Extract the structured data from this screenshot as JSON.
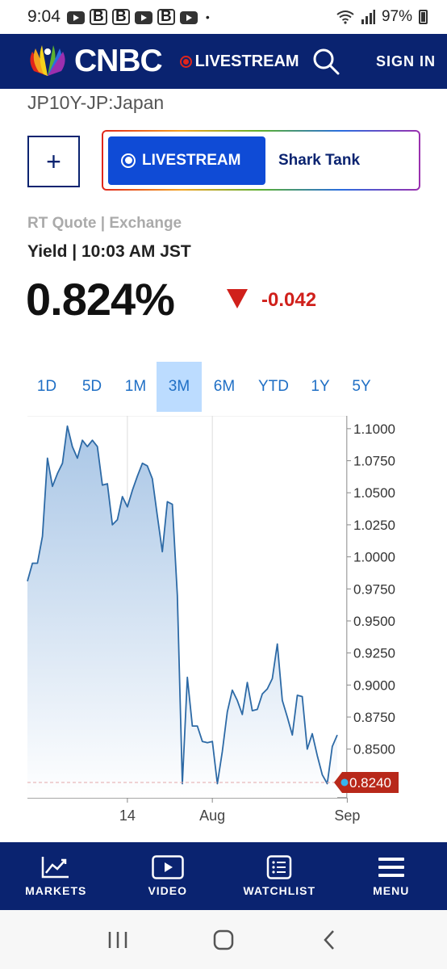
{
  "status_bar": {
    "time": "9:04",
    "notif_b": "B",
    "dot": "•",
    "battery": "97%"
  },
  "header": {
    "brand": "CNBC",
    "livestream": "LIVESTREAM",
    "sign_in": "SIGN IN"
  },
  "page_title": "JP10Y-JP:Japan",
  "promo": {
    "plus": "+",
    "live_label": "LIVESTREAM",
    "show": "Shark Tank"
  },
  "quote": {
    "meta": "RT Quote | Exchange",
    "yield_line": "Yield | 10:03 AM JST",
    "price": "0.824%",
    "change": "-0.042"
  },
  "ranges": [
    {
      "label": "1D",
      "active": false
    },
    {
      "label": "5D",
      "active": false
    },
    {
      "label": "1M",
      "active": false
    },
    {
      "label": "3M",
      "active": true
    },
    {
      "label": "6M",
      "active": false
    },
    {
      "label": "YTD",
      "active": false
    },
    {
      "label": "1Y",
      "active": false
    },
    {
      "label": "5Y",
      "active": false
    }
  ],
  "chart_data": {
    "type": "area",
    "ylim": [
      0.812,
      1.11
    ],
    "yticks": [
      "1.1000",
      "1.0750",
      "1.0500",
      "1.0250",
      "1.0000",
      "0.9750",
      "0.9500",
      "0.9250",
      "0.9000",
      "0.8750",
      "0.8500"
    ],
    "xticks": [
      {
        "label": "14",
        "x": 20
      },
      {
        "label": "Aug",
        "x": 37
      },
      {
        "label": "Sep",
        "x": 64
      }
    ],
    "last_value": "0.8240",
    "last": 0.824,
    "line_color": "#2d6aa6",
    "fill_top": "#a9c6e6",
    "values": [
      0.981,
      0.995,
      0.995,
      1.016,
      1.077,
      1.055,
      1.065,
      1.073,
      1.102,
      1.086,
      1.077,
      1.091,
      1.086,
      1.091,
      1.086,
      1.056,
      1.057,
      1.025,
      1.029,
      1.047,
      1.039,
      1.052,
      1.063,
      1.073,
      1.071,
      1.061,
      1.032,
      1.004,
      1.043,
      1.041,
      0.97,
      0.823,
      0.906,
      0.868,
      0.868,
      0.856,
      0.855,
      0.856,
      0.823,
      0.848,
      0.879,
      0.896,
      0.888,
      0.877,
      0.902,
      0.88,
      0.881,
      0.893,
      0.897,
      0.905,
      0.932,
      0.888,
      0.875,
      0.861,
      0.892,
      0.891,
      0.85,
      0.862,
      0.845,
      0.83,
      0.823,
      0.852,
      0.861
    ]
  },
  "bottom_nav": [
    {
      "label": "MARKETS",
      "icon": "chart-line-icon"
    },
    {
      "label": "VIDEO",
      "icon": "play-icon"
    },
    {
      "label": "WATCHLIST",
      "icon": "list-icon"
    },
    {
      "label": "MENU",
      "icon": "hamburger-icon"
    }
  ]
}
